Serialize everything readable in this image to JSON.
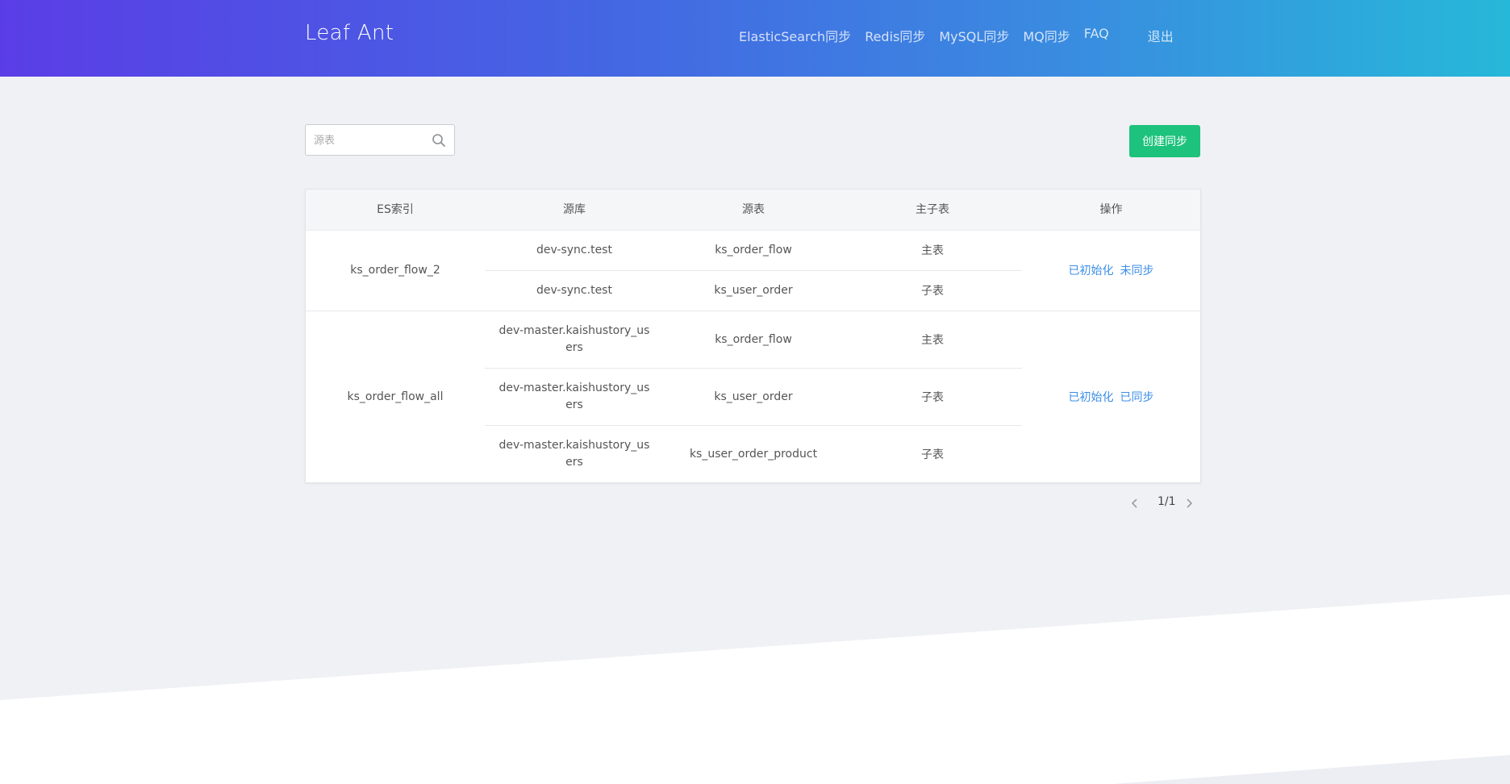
{
  "header": {
    "logo": "Leaf Ant",
    "nav": [
      "ElasticSearch同步",
      "Redis同步",
      "MySQL同步",
      "MQ同步",
      "FAQ"
    ],
    "logout": "退出"
  },
  "toolbar": {
    "search_placeholder": "源表",
    "search_icon": "search-icon",
    "create_button": "创建同步"
  },
  "table": {
    "headers": [
      "ES索引",
      "源库",
      "源表",
      "主子表",
      "操作"
    ],
    "groups": [
      {
        "index": "ks_order_flow_2",
        "rows": [
          {
            "db": "dev-sync.test",
            "table": "ks_order_flow",
            "type": "主表"
          },
          {
            "db": "dev-sync.test",
            "table": "ks_user_order",
            "type": "子表"
          }
        ],
        "actions": [
          "已初始化",
          "未同步"
        ]
      },
      {
        "index": "ks_order_flow_all",
        "rows": [
          {
            "db": "dev-master.kaishustory_users",
            "table": "ks_order_flow",
            "type": "主表"
          },
          {
            "db": "dev-master.kaishustory_users",
            "table": "ks_user_order",
            "type": "子表"
          },
          {
            "db": "dev-master.kaishustory_users",
            "table": "ks_user_order_product",
            "type": "子表"
          }
        ],
        "actions": [
          "已初始化",
          "已同步"
        ]
      }
    ]
  },
  "pagination": {
    "page": "1/1",
    "prev_icon": "chevron-left-icon",
    "next_icon": "chevron-right-icon"
  },
  "colors": {
    "header_gradient_start": "#5a3de6",
    "header_gradient_end": "#26b8d9",
    "primary_button": "#1dc27c",
    "link": "#3b8ee8"
  }
}
